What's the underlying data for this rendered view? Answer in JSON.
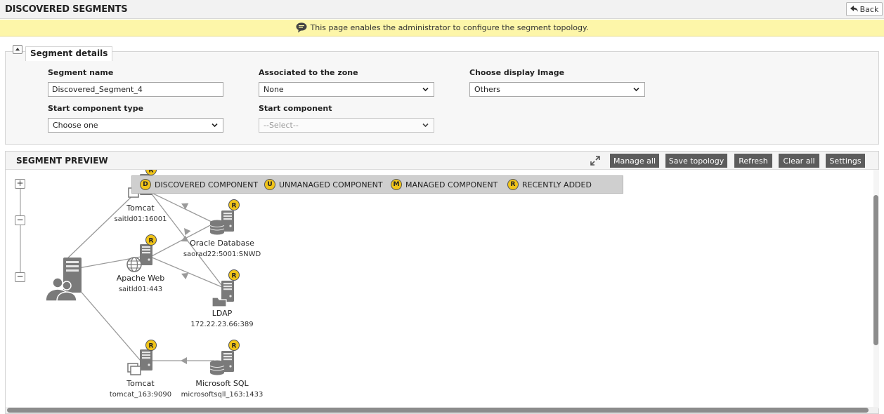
{
  "header": {
    "title": "DISCOVERED SEGMENTS",
    "back_label": "Back"
  },
  "info": {
    "message": "This page enables the administrator to configure the segment topology."
  },
  "segment_details": {
    "legend": "Segment details",
    "segment_name": {
      "label": "Segment name",
      "value": "Discovered_Segment_4"
    },
    "zone": {
      "label": "Associated to the zone",
      "value": "None"
    },
    "display_image": {
      "label": "Choose display Image",
      "value": "Others"
    },
    "start_type": {
      "label": "Start component type",
      "value": "Choose one"
    },
    "start_component": {
      "label": "Start component",
      "value": "--Select--"
    }
  },
  "preview": {
    "title": "SEGMENT PREVIEW",
    "buttons": {
      "manage_all": "Manage all",
      "save_topology": "Save topology",
      "refresh": "Refresh",
      "clear_all": "Clear all",
      "settings": "Settings"
    },
    "legend": [
      {
        "badge": "D",
        "label": "DISCOVERED COMPONENT"
      },
      {
        "badge": "U",
        "label": "UNMANAGED COMPONENT"
      },
      {
        "badge": "M",
        "label": "MANAGED COMPONENT"
      },
      {
        "badge": "R",
        "label": "RECENTLY ADDED"
      }
    ],
    "zoom": {
      "in": "+",
      "mid": "−",
      "out": "−"
    },
    "nodes": {
      "tomcat1": {
        "name": "Tomcat",
        "address": "saitld01:16001",
        "badge": "R"
      },
      "oracle": {
        "name": "Oracle Database",
        "address": "saorad22:5001:SNWD",
        "badge": "R"
      },
      "apache": {
        "name": "Apache Web",
        "address": "saitld01:443",
        "badge": "R"
      },
      "ldap": {
        "name": "LDAP",
        "address": "172.22.23.66:389",
        "badge": "R"
      },
      "tomcat2": {
        "name": "Tomcat",
        "address": "tomcat_163:9090",
        "badge": "R"
      },
      "mssql": {
        "name": "Microsoft SQL",
        "address": "microsoftsqll_163:1433",
        "badge": "R"
      }
    }
  },
  "colors": {
    "badge": "#f0c419",
    "infobar": "#fdf6a9",
    "button_dark": "#5c5c5c",
    "icon_gray": "#777777"
  }
}
